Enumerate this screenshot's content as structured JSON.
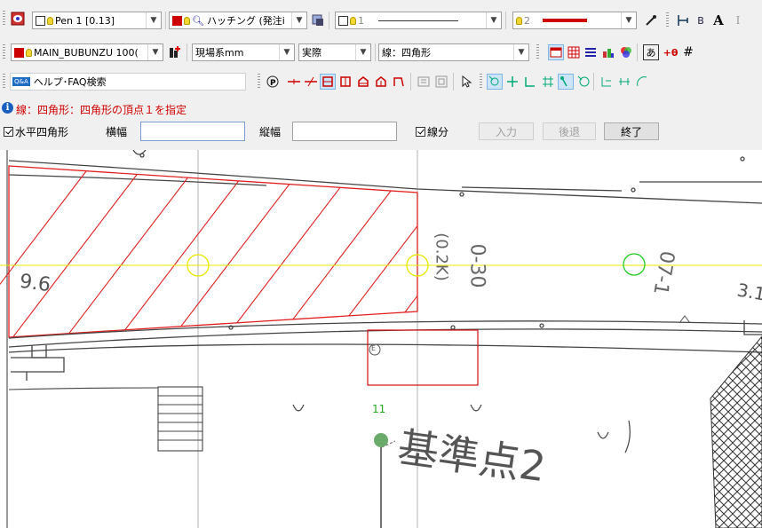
{
  "toolbar1": {
    "layer_pen": "Pen 1 [0.13]",
    "hatching": "ハッチング (発注i",
    "line_type": "1",
    "line_width": "2"
  },
  "toolbar2": {
    "layer": "MAIN_BUBUNZU 100(",
    "coord_system": "現場系mm",
    "scale_mode": "実際",
    "command": "線：四角形"
  },
  "toolbar3": {
    "help_search": "ヘルプ･FAQ検索",
    "help_badge": "Q&A"
  },
  "status": {
    "message": "線：四角形：四角形の頂点１を指定",
    "color": "#d00000"
  },
  "options": {
    "horizontal_rect_label": "水平四角形",
    "width_label": "横幅",
    "width_value": "",
    "height_label": "縦幅",
    "height_value": "",
    "segment_label": "線分",
    "input_button": "入力",
    "back_button": "後退",
    "end_button": "終了"
  },
  "drawing": {
    "label_96": "9.6",
    "label_11": "11",
    "label_base": "基準点2",
    "label_v1": "(0.2K)",
    "label_v2": "0-30",
    "label_v3": "07-1",
    "label_31": "3.1",
    "label_e": "E",
    "colors": {
      "construction": "#e8e800",
      "hatch": "#e02020",
      "marker": "#22cc22",
      "base_point": "#6aaa6a"
    }
  }
}
